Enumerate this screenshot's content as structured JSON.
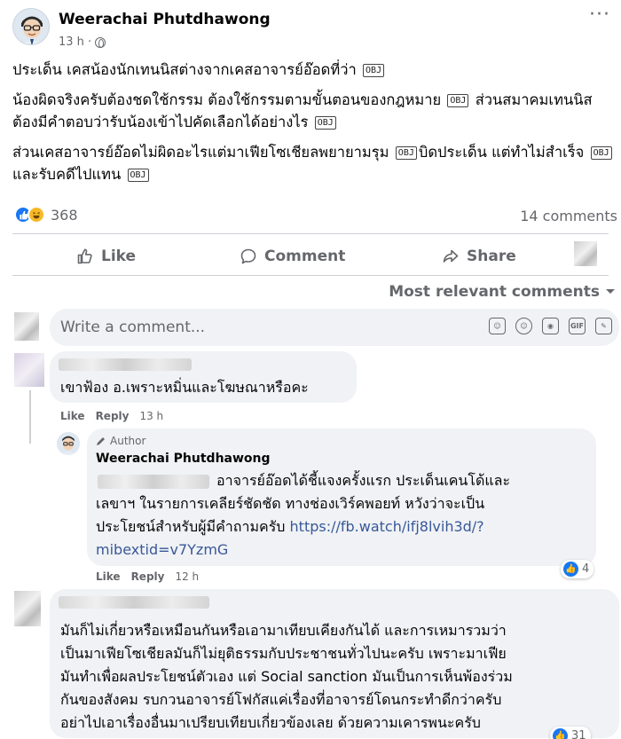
{
  "post": {
    "author": "Weerachai Phutdhawong",
    "time": "13 h ·",
    "paragraphs": [
      [
        "ประเด็น เคสน้องนักเทนนิสต่างจากเคสอาจารย์อ๊อดที่ว่า"
      ],
      [
        "น้องผิดจริงครับต้องชดใช้กรรม ต้องใช้กรรมตามขั้นตอนของกฎหมาย",
        "ส่วนสมาคมเทนนิสต้องมีคำตอบว่ารับน้องเข้าไปคัดเลือกได้อย่างไร"
      ],
      [
        "ส่วนเคสอาจารย์อ๊อดไม่ผิดอะไรแต่มาเฟียโซเชียลพยายามรุม",
        "บิดประเด็น  แต่ทำไม่สำเร็จ",
        "และรับคดีไปแทน"
      ]
    ],
    "obj_glyph": "OBJ",
    "reaction_count": "368",
    "comments_count": "14 comments"
  },
  "actions": {
    "like": "Like",
    "comment": "Comment",
    "share": "Share"
  },
  "sort_label": "Most relevant comments",
  "write_placeholder": "Write a comment...",
  "comments": [
    {
      "text": "เขาฟ้อง อ.เพราะหมิ่นและโฆษณาหรือคะ",
      "like": "Like",
      "reply": "Reply",
      "time": "13 h"
    },
    {
      "author_badge": "Author",
      "name": "Weerachai Phutdhawong",
      "text": "อาจารย์อ๊อดได้ชี้แจงครั้งแรก ประเด็นเคนโด้และ",
      "text2": "เลขาฯ ในรายการเคลียร์ชัดชัด ทางช่องเวิร์คพอยท์ หวังว่าจะเป็น",
      "text3": "ประโยชน์สำหรับผู้มีคำถามครับ",
      "link1": "https://fb.watch/ifj8lvih3d/?",
      "link2": "mibextid=v7YzmG",
      "like_count": "4",
      "like": "Like",
      "reply": "Reply",
      "time": "12 h"
    },
    {
      "lines": [
        "มันก็ไม่เกี่ยวหรือเหมือนกันหรือเอามาเทียบเคียงกันได้ และการเหมารวมว่า",
        "เป็นมาเฟียโซเชียลมันก็ไม่ยุติธรรมกับประชาชนทั่วไปนะครับ เพราะมาเฟีย",
        "มันทำเพื่อผลประโยชน์ตัวเอง แต่ Social sanction มันเป็นการเห็นพ้องร่วม",
        "กันของสังคม รบกวนอาจารย์โฟกัสแค่เรื่องที่อาจารย์โดนกระทำดีกว่าครับ",
        "อย่าไปเอาเรื่องอื่นมาเปรียบเทียบเกี่ยวข้องเลย ด้วยความเคารพนะครับ"
      ],
      "like_count": "31"
    }
  ],
  "colors": {
    "link": "#385898",
    "like_blue": "#1877f2",
    "muted": "#65676b",
    "bubble": "#f0f2f5"
  }
}
